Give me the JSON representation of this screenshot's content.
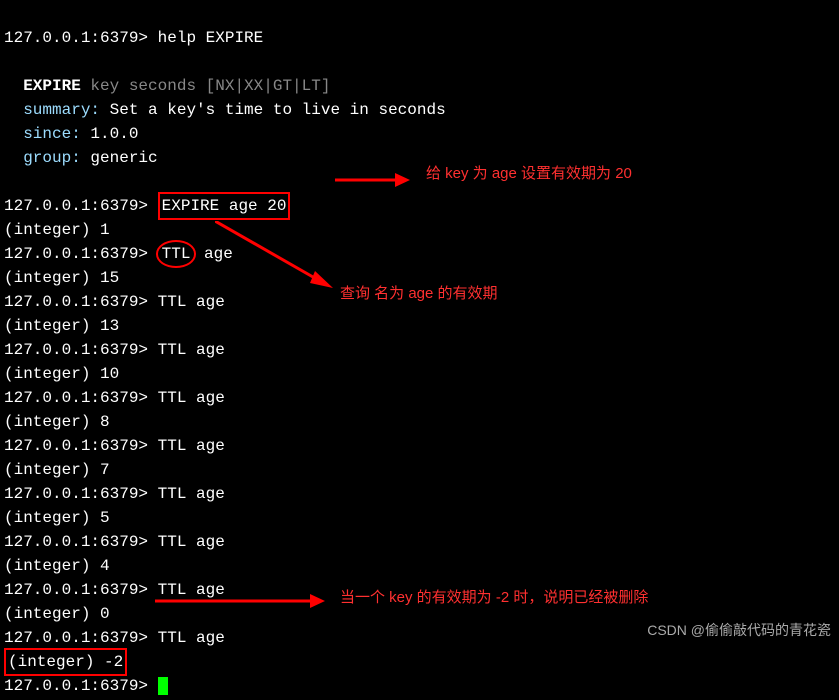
{
  "prompt": "127.0.0.1:6379>",
  "help_cmd": "help EXPIRE",
  "help": {
    "name": "EXPIRE",
    "usage": "key seconds [NX|XX|GT|LT]",
    "summary_label": "summary:",
    "summary": "Set a key's time to live in seconds",
    "since_label": "since:",
    "since": "1.0.0",
    "group_label": "group:",
    "group": "generic"
  },
  "expire_cmd": "EXPIRE age 20",
  "expire_result": "(integer) 1",
  "ttl_circled": "TTL",
  "ttl_rest": " age",
  "ttl_cmd": "TTL age",
  "ttl_results": [
    "(integer) 15",
    "(integer) 13",
    "(integer) 10",
    "(integer) 8",
    "(integer) 7",
    "(integer) 5",
    "(integer) 4",
    "(integer) 0",
    "(integer) -2"
  ],
  "annotations": {
    "a1": "给 key 为 age 设置有效期为 20",
    "a2": "查询 名为 age 的有效期",
    "a3": "当一个 key 的有效期为 -2 时，说明已经被删除"
  },
  "watermark": "CSDN @偷偷敲代码的青花瓷"
}
